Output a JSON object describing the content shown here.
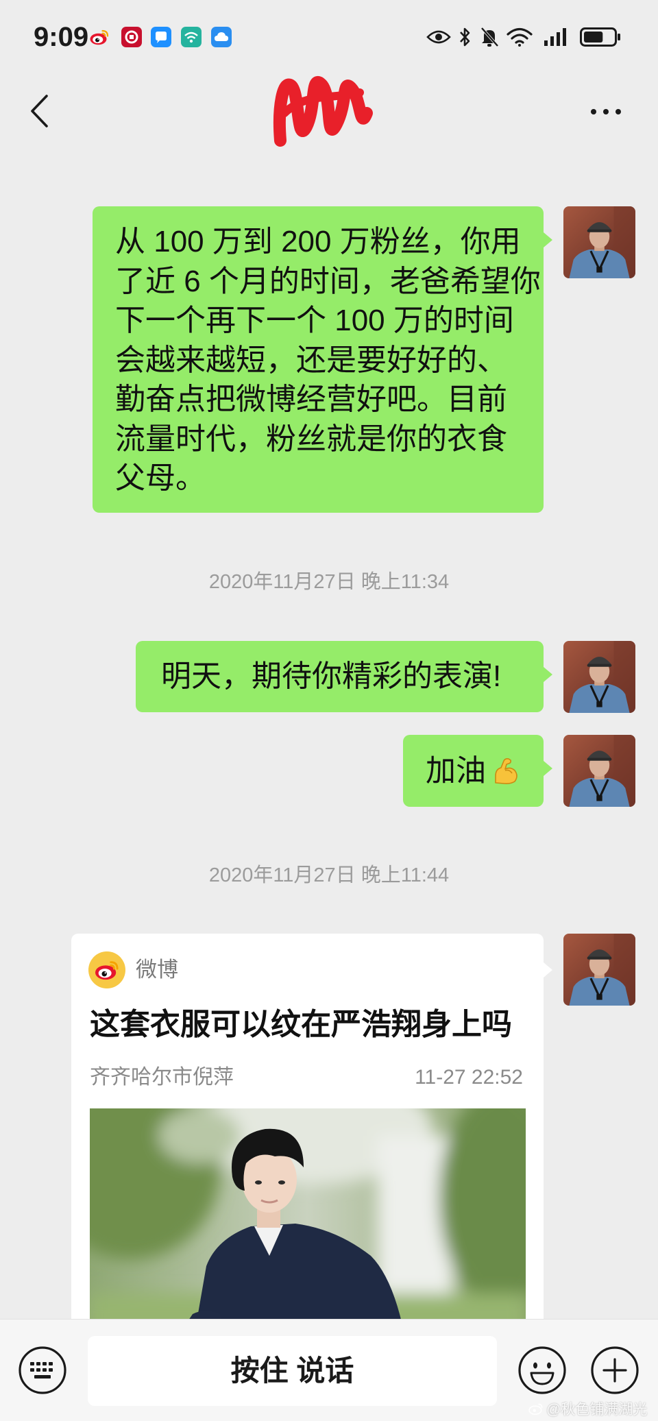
{
  "status_bar": {
    "time": "9:09",
    "app_icons": [
      "weibo-icon",
      "bank-icon",
      "message-icon",
      "wifi-app-icon",
      "cloud-icon"
    ],
    "system_icons": [
      "eye-icon",
      "bluetooth-icon",
      "mute-bell-icon",
      "wifi-icon",
      "signal-icon",
      "battery-icon"
    ],
    "battery_level": 0.65
  },
  "header": {
    "back_icon": "chevron-left-icon",
    "more_icon": "more-dots-icon"
  },
  "chat": {
    "message_1": {
      "direction": "sent",
      "lines": [
        "从 100 万到 200 万粉丝，你用",
        "了近 6 个月的时间，老爸希望你",
        "下一个再下一个 100 万的时间",
        "会越来越短，还是要好好的、",
        "勤奋点把微博经营好吧。目前",
        "流量时代，粉丝就是你的衣食",
        "父母。"
      ]
    },
    "timestamp_1": "2020年11月27日 晚上11:34",
    "message_2": {
      "direction": "sent",
      "text": "明天，期待你精彩的表演!"
    },
    "message_3": {
      "direction": "sent",
      "text": "加油",
      "emoji_icon": "flexed-biceps-icon"
    },
    "timestamp_2": "2020年11月27日 晚上11:44",
    "shared_card": {
      "source_icon": "weibo-logo-icon",
      "source": "微博",
      "title": "这套衣服可以纹在严浩翔身上吗",
      "author": "齐齐哈尔市倪萍",
      "time": "11-27 22:52"
    }
  },
  "input_bar": {
    "keyboard_icon": "keyboard-icon",
    "voice_button": "按住 说话",
    "emoji_icon": "smile-icon",
    "plus_icon": "plus-icon"
  },
  "watermark": "@秋色铺满湖光",
  "colors": {
    "background": "#ededed",
    "sent_bubble": "#95ec69",
    "card": "#ffffff",
    "timestamp": "#9b9b9b",
    "input_bar": "#f6f6f6"
  }
}
